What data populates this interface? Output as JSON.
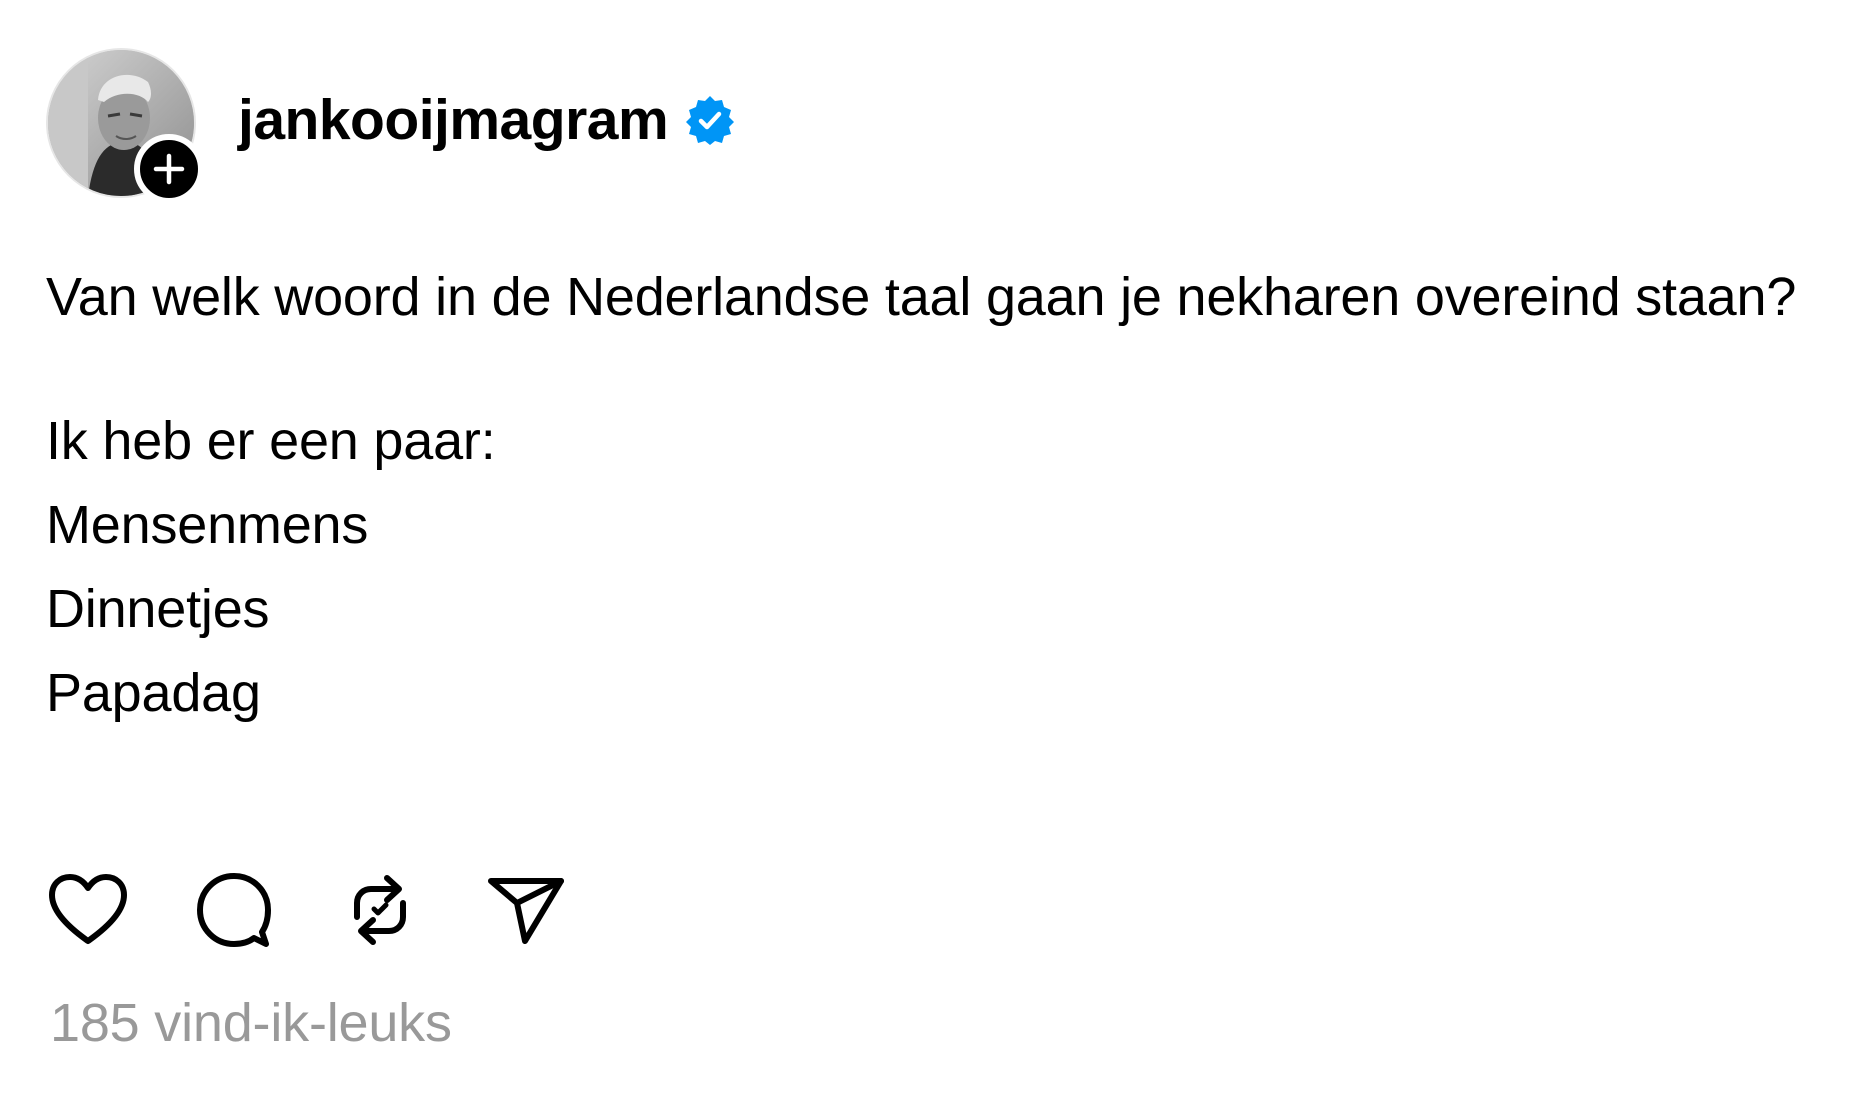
{
  "post": {
    "author": {
      "username": "jankooijmagram",
      "verified": true,
      "verified_icon": "verified-badge-icon",
      "avatar_icon": "profile-photo",
      "follow_icon": "plus-icon"
    },
    "text": {
      "paragraph1": "Van welk woord in de Nederlandse taal gaan je nekharen overeind staan?",
      "lines": [
        "Ik heb er een paar:",
        "Mensenmens",
        "Dinnetjes",
        "Papadag"
      ]
    },
    "actions": [
      {
        "name": "like",
        "icon": "heart-icon"
      },
      {
        "name": "reply",
        "icon": "speech-bubble-icon"
      },
      {
        "name": "repost",
        "icon": "repost-icon"
      },
      {
        "name": "share",
        "icon": "send-icon"
      }
    ],
    "likes_text": "185 vind-ik-leuks"
  },
  "colors": {
    "text": "#000000",
    "muted": "#999999",
    "verified_blue": "#0095F6",
    "badge_black": "#000000"
  }
}
